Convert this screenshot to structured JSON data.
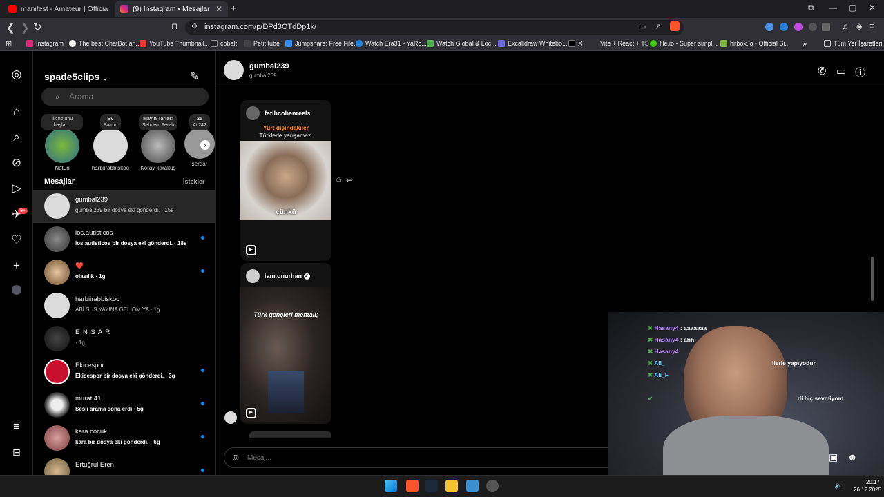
{
  "browser": {
    "tabs": [
      {
        "label": "manifest - Amateur | Official Music V",
        "active": false
      },
      {
        "label": "(9) Instagram • Mesajlar",
        "active": true
      }
    ],
    "url": "instagram.com/p/DPd3OTdDp1k/",
    "bookmarks": [
      "Instagram",
      "The best ChatBot an...",
      "YouTube Thumbnail...",
      "cobalt",
      "Petit tube",
      "Jumpshare: Free File...",
      "Watch Era31 - YaRo...",
      "Watch Global & Loc...",
      "Excalidraw Whitebo...",
      "X",
      "Vite + React + TS",
      "file.io - Super simpl...",
      "hitbox.io - Official Si...",
      "Tüm Yer İşaretleri"
    ]
  },
  "sidebar": {
    "account": "spade5clips",
    "search_placeholder": "Arama",
    "notes": [
      {
        "note": "İlk notunu başlat...",
        "name": "Notun"
      },
      {
        "note": "EV",
        "sub": "Patron",
        "name": "harbiirabbiskoo"
      },
      {
        "note": "Mayın Tarlası",
        "sub": "Şebnem Ferah",
        "name": "Koray karakuş"
      },
      {
        "note": "25",
        "sub": "Ati242",
        "name": "serdar"
      }
    ],
    "messages_header": "Mesajlar",
    "requests_label": "İstekler",
    "badge_count": "9+",
    "conversations": [
      {
        "name": "gumbal239",
        "preview": "gumbal239 bir dosya eki gönderdi. · 15s",
        "unread": false,
        "active": true
      },
      {
        "name": "los.autisticos",
        "preview": "los.autisticos bir dosya eki gönderdi. · 18s",
        "unread": true
      },
      {
        "name": "❤️",
        "preview": "olasılık · 1g",
        "unread": true
      },
      {
        "name": "harbiirabbiskoo",
        "preview": "ABİ SUS YAYINA GELİOM YA · 1g",
        "unread": false
      },
      {
        "name": "E N S A R",
        "preview": "· 1g",
        "unread": false
      },
      {
        "name": "Ekicespor",
        "preview": "Ekicespor bir dosya eki gönderdi. · 3g",
        "unread": true
      },
      {
        "name": "murat.41",
        "preview": "Sesli arama sona erdi · 5g",
        "unread": true
      },
      {
        "name": "kara cocuk",
        "preview": "kara bir dosya eki gönderdi. · 6g",
        "unread": true
      },
      {
        "name": "Ertuğrul Eren",
        "preview": "",
        "unread": true
      }
    ]
  },
  "chat": {
    "name": "gumbal239",
    "handle": "gumbal239",
    "reels": [
      {
        "author": "fatihcobanreels",
        "caption_top": "Yurt dışındakiler",
        "caption_mid": "Türklerle yarışamaz.",
        "subtitle": "çünkü"
      },
      {
        "author": "iam.onurhan",
        "verified": true,
        "caption": "Türk gençleri mentali;"
      }
    ],
    "composer_placeholder": "Mesaj..."
  },
  "stream_chat": [
    {
      "user": "Hasany4",
      "text": ": aaaaaaa"
    },
    {
      "user": "Hasany4",
      "text": ": ahh"
    },
    {
      "user": "Hasany4",
      "text": ""
    },
    {
      "user": "Ali_",
      "text": "ilerle yapıyodur"
    },
    {
      "user": "Ali_F",
      "text": ""
    },
    {
      "user": "",
      "text": "di hiç sevmiyom"
    }
  ],
  "taskbar": {
    "time": "20:17",
    "date": "26.12.2025"
  },
  "colors": {
    "accent": "#0095f6",
    "badge": "#ff3040"
  }
}
